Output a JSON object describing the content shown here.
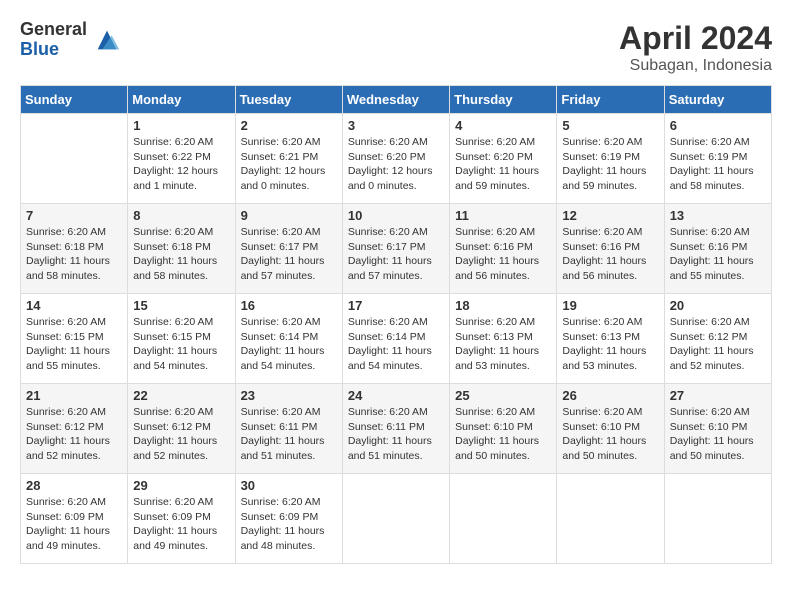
{
  "logo": {
    "general": "General",
    "blue": "Blue"
  },
  "title": "April 2024",
  "location": "Subagan, Indonesia",
  "weekdays": [
    "Sunday",
    "Monday",
    "Tuesday",
    "Wednesday",
    "Thursday",
    "Friday",
    "Saturday"
  ],
  "weeks": [
    [
      {
        "day": "",
        "info": ""
      },
      {
        "day": "1",
        "info": "Sunrise: 6:20 AM\nSunset: 6:22 PM\nDaylight: 12 hours\nand 1 minute."
      },
      {
        "day": "2",
        "info": "Sunrise: 6:20 AM\nSunset: 6:21 PM\nDaylight: 12 hours\nand 0 minutes."
      },
      {
        "day": "3",
        "info": "Sunrise: 6:20 AM\nSunset: 6:20 PM\nDaylight: 12 hours\nand 0 minutes."
      },
      {
        "day": "4",
        "info": "Sunrise: 6:20 AM\nSunset: 6:20 PM\nDaylight: 11 hours\nand 59 minutes."
      },
      {
        "day": "5",
        "info": "Sunrise: 6:20 AM\nSunset: 6:19 PM\nDaylight: 11 hours\nand 59 minutes."
      },
      {
        "day": "6",
        "info": "Sunrise: 6:20 AM\nSunset: 6:19 PM\nDaylight: 11 hours\nand 58 minutes."
      }
    ],
    [
      {
        "day": "7",
        "info": "Sunrise: 6:20 AM\nSunset: 6:18 PM\nDaylight: 11 hours\nand 58 minutes."
      },
      {
        "day": "8",
        "info": "Sunrise: 6:20 AM\nSunset: 6:18 PM\nDaylight: 11 hours\nand 58 minutes."
      },
      {
        "day": "9",
        "info": "Sunrise: 6:20 AM\nSunset: 6:17 PM\nDaylight: 11 hours\nand 57 minutes."
      },
      {
        "day": "10",
        "info": "Sunrise: 6:20 AM\nSunset: 6:17 PM\nDaylight: 11 hours\nand 57 minutes."
      },
      {
        "day": "11",
        "info": "Sunrise: 6:20 AM\nSunset: 6:16 PM\nDaylight: 11 hours\nand 56 minutes."
      },
      {
        "day": "12",
        "info": "Sunrise: 6:20 AM\nSunset: 6:16 PM\nDaylight: 11 hours\nand 56 minutes."
      },
      {
        "day": "13",
        "info": "Sunrise: 6:20 AM\nSunset: 6:16 PM\nDaylight: 11 hours\nand 55 minutes."
      }
    ],
    [
      {
        "day": "14",
        "info": "Sunrise: 6:20 AM\nSunset: 6:15 PM\nDaylight: 11 hours\nand 55 minutes."
      },
      {
        "day": "15",
        "info": "Sunrise: 6:20 AM\nSunset: 6:15 PM\nDaylight: 11 hours\nand 54 minutes."
      },
      {
        "day": "16",
        "info": "Sunrise: 6:20 AM\nSunset: 6:14 PM\nDaylight: 11 hours\nand 54 minutes."
      },
      {
        "day": "17",
        "info": "Sunrise: 6:20 AM\nSunset: 6:14 PM\nDaylight: 11 hours\nand 54 minutes."
      },
      {
        "day": "18",
        "info": "Sunrise: 6:20 AM\nSunset: 6:13 PM\nDaylight: 11 hours\nand 53 minutes."
      },
      {
        "day": "19",
        "info": "Sunrise: 6:20 AM\nSunset: 6:13 PM\nDaylight: 11 hours\nand 53 minutes."
      },
      {
        "day": "20",
        "info": "Sunrise: 6:20 AM\nSunset: 6:12 PM\nDaylight: 11 hours\nand 52 minutes."
      }
    ],
    [
      {
        "day": "21",
        "info": "Sunrise: 6:20 AM\nSunset: 6:12 PM\nDaylight: 11 hours\nand 52 minutes."
      },
      {
        "day": "22",
        "info": "Sunrise: 6:20 AM\nSunset: 6:12 PM\nDaylight: 11 hours\nand 52 minutes."
      },
      {
        "day": "23",
        "info": "Sunrise: 6:20 AM\nSunset: 6:11 PM\nDaylight: 11 hours\nand 51 minutes."
      },
      {
        "day": "24",
        "info": "Sunrise: 6:20 AM\nSunset: 6:11 PM\nDaylight: 11 hours\nand 51 minutes."
      },
      {
        "day": "25",
        "info": "Sunrise: 6:20 AM\nSunset: 6:10 PM\nDaylight: 11 hours\nand 50 minutes."
      },
      {
        "day": "26",
        "info": "Sunrise: 6:20 AM\nSunset: 6:10 PM\nDaylight: 11 hours\nand 50 minutes."
      },
      {
        "day": "27",
        "info": "Sunrise: 6:20 AM\nSunset: 6:10 PM\nDaylight: 11 hours\nand 50 minutes."
      }
    ],
    [
      {
        "day": "28",
        "info": "Sunrise: 6:20 AM\nSunset: 6:09 PM\nDaylight: 11 hours\nand 49 minutes."
      },
      {
        "day": "29",
        "info": "Sunrise: 6:20 AM\nSunset: 6:09 PM\nDaylight: 11 hours\nand 49 minutes."
      },
      {
        "day": "30",
        "info": "Sunrise: 6:20 AM\nSunset: 6:09 PM\nDaylight: 11 hours\nand 48 minutes."
      },
      {
        "day": "",
        "info": ""
      },
      {
        "day": "",
        "info": ""
      },
      {
        "day": "",
        "info": ""
      },
      {
        "day": "",
        "info": ""
      }
    ]
  ]
}
